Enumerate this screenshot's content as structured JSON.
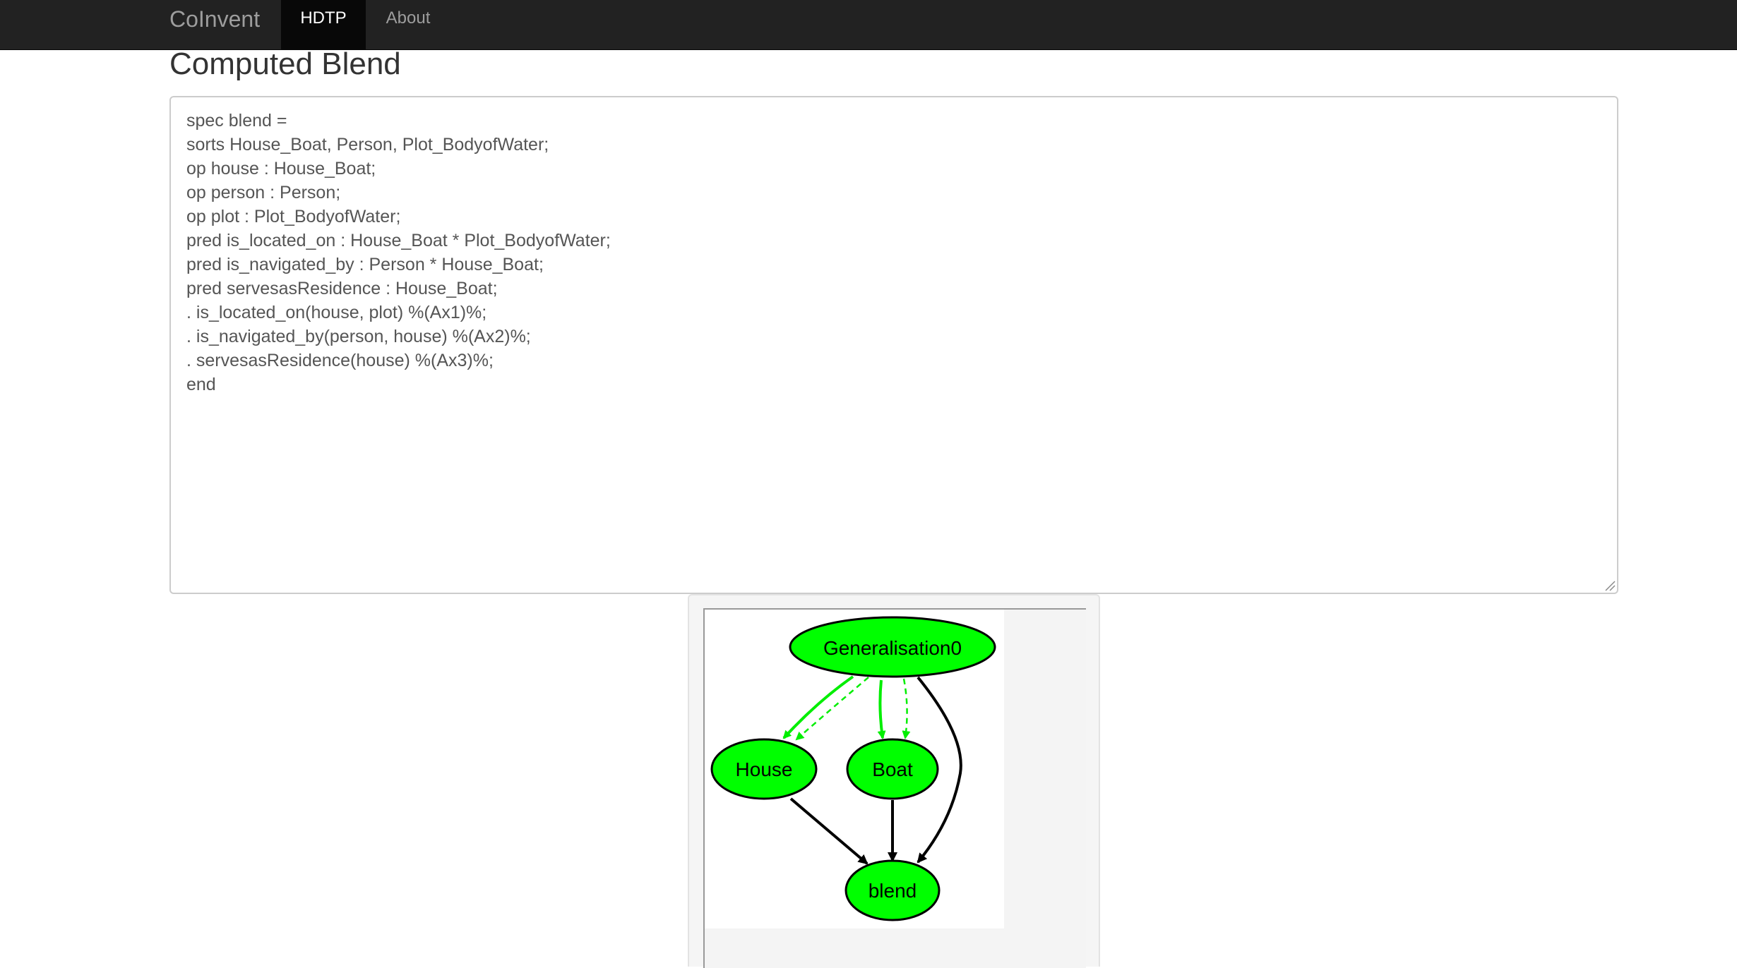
{
  "navbar": {
    "brand": "CoInvent",
    "items": [
      {
        "label": "HDTP",
        "active": true
      },
      {
        "label": "About",
        "active": false
      }
    ]
  },
  "page": {
    "title": "Computed Blend"
  },
  "editor": {
    "content": "spec blend =\nsorts House_Boat, Person, Plot_BodyofWater;\nop house : House_Boat;\nop person : Person;\nop plot : Plot_BodyofWater;\npred is_located_on : House_Boat * Plot_BodyofWater;\npred is_navigated_by : Person * House_Boat;\npred servesasResidence : House_Boat;\n. is_located_on(house, plot) %(Ax1)%;\n. is_navigated_by(person, house) %(Ax2)%;\n. servesasResidence(house) %(Ax3)%;\nend"
  },
  "graph": {
    "node_color": "#00ff00",
    "edge_green": "#00ee00",
    "edge_black": "#000000",
    "nodes": {
      "generalisation": "Generalisation0",
      "house": "House",
      "boat": "Boat",
      "blend": "blend"
    }
  }
}
